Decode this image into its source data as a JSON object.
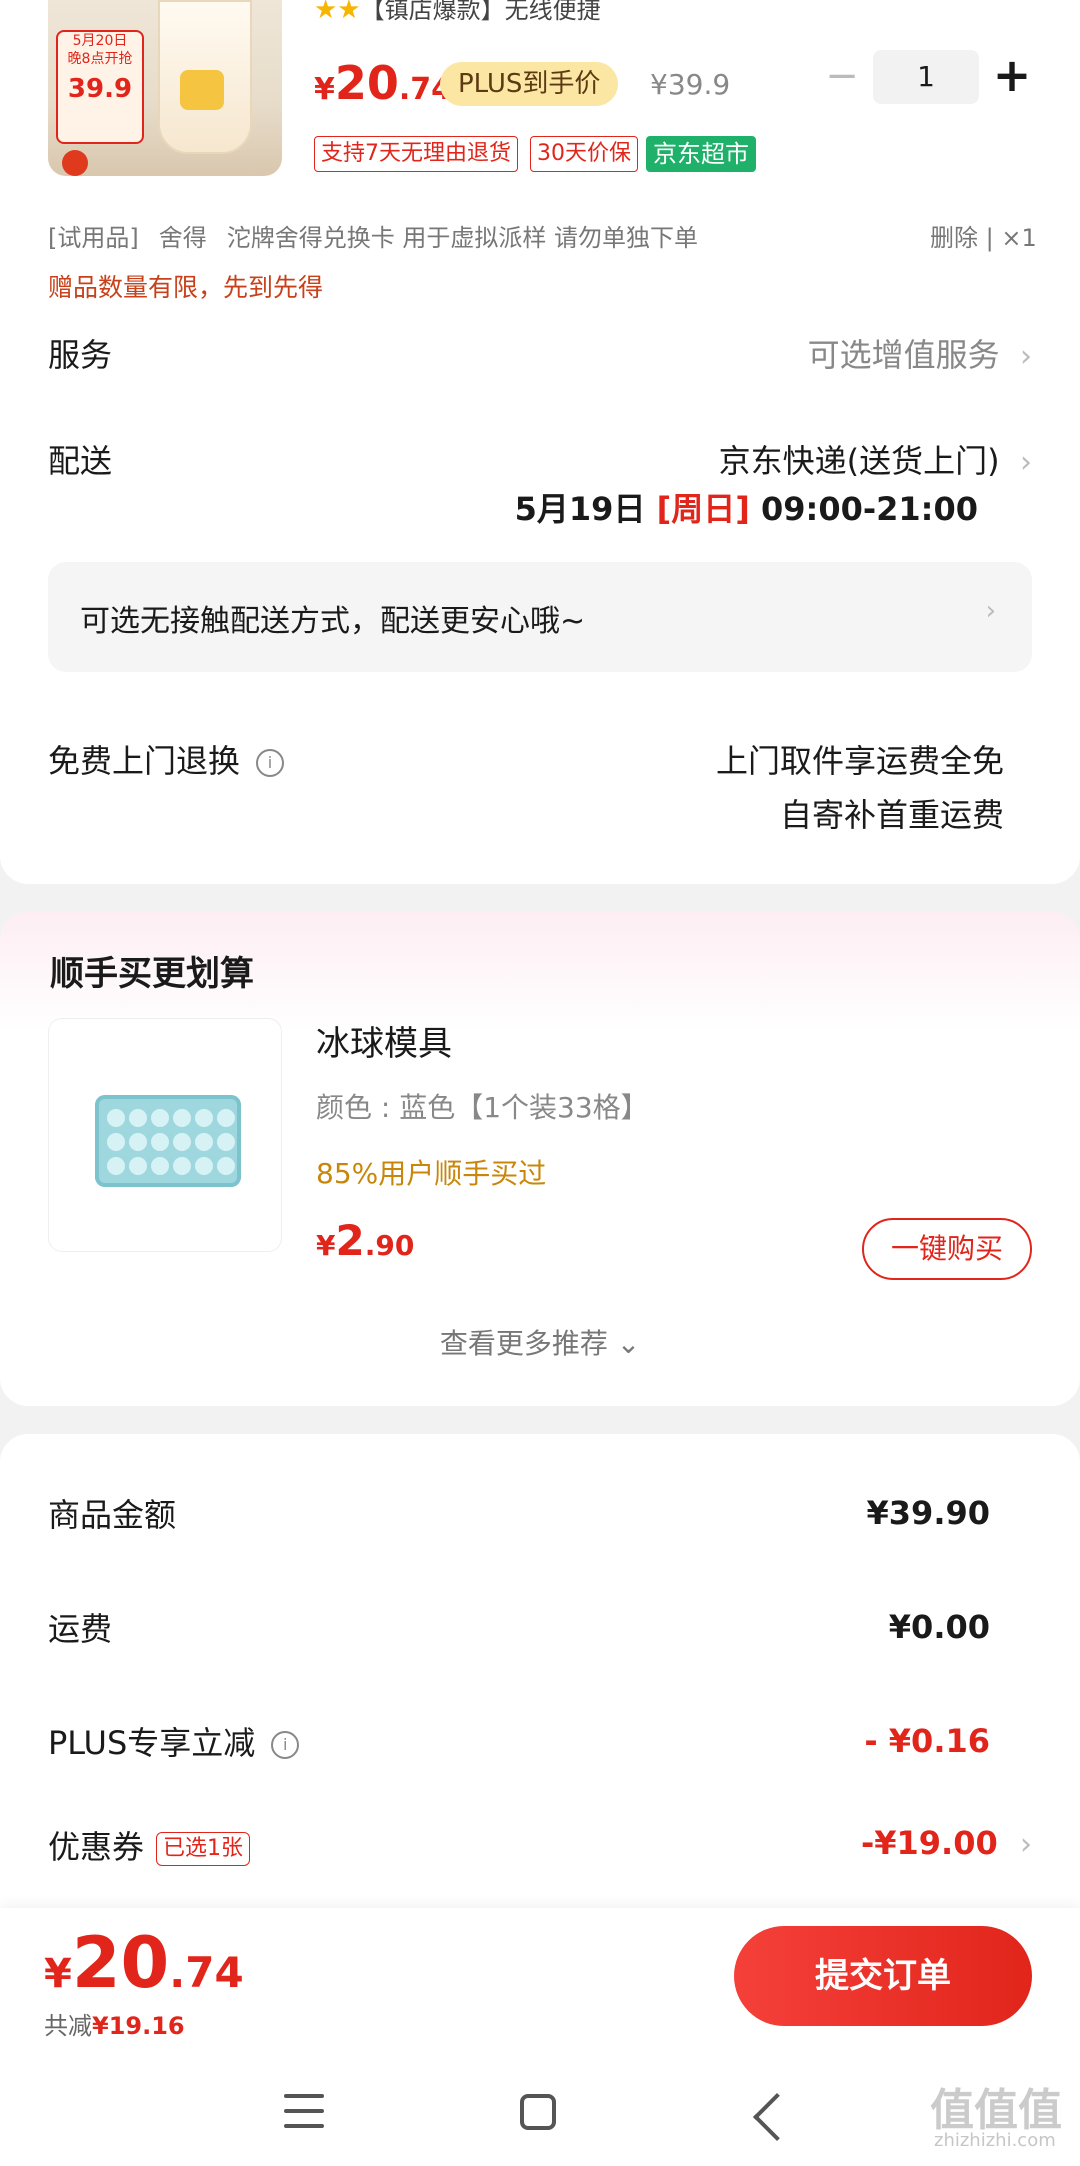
{
  "product": {
    "title": "【镇店爆款】无线便捷",
    "stars": "★★",
    "thumb_badge_line1": "5月20日",
    "thumb_badge_line2": "晚8点开抢",
    "thumb_badge_price": "39.9",
    "price_currency": "¥",
    "price_int": "20",
    "price_dec": ".74",
    "plus_tag": "PLUS到手价",
    "original_price": "¥39.9",
    "quantity": "1",
    "minus_label": "−",
    "plus_label": "+",
    "tags": [
      "支持7天无理由退货",
      "30天价保"
    ],
    "supermarket_tag": "京东超市"
  },
  "gift": {
    "prefix": "[试用品]",
    "brand": "舍得",
    "name": "沱牌舍得兑换卡 用于虚拟派样 请勿单独下单",
    "delete": "删除",
    "qty": "×1",
    "note": "赠品数量有限，先到先得"
  },
  "service": {
    "label": "服务",
    "value": "可选增值服务"
  },
  "delivery": {
    "label": "配送",
    "method": "京东快递(送货上门)",
    "date": "5月19日",
    "weekday": "[周日]",
    "time": "09:00-21:00",
    "contactless": "可选无接触配送方式，配送更安心哦~"
  },
  "returns": {
    "label": "免费上门退换",
    "line1": "上门取件享运费全免",
    "line2": "自寄补首重运费"
  },
  "recommend": {
    "title": "顺手买更划算",
    "item_name": "冰球模具",
    "item_attr": "颜色 : 蓝色【1个装33格】",
    "item_bought": "85%用户顺手买过",
    "price_currency": "¥",
    "price_int": "2",
    "price_dec": ".90",
    "buy_label": "一键购买",
    "see_more": "查看更多推荐 ⌄"
  },
  "summary": {
    "goods_label": "商品金额",
    "goods_value": "¥39.90",
    "shipping_label": "运费",
    "shipping_value": "¥0.00",
    "plus_label": "PLUS专享立减",
    "plus_value": "- ¥0.16",
    "coupon_label": "优惠券",
    "coupon_tag": "已选1张",
    "coupon_value": "-¥19.00"
  },
  "footer": {
    "total_currency": "¥",
    "total_int": "20",
    "total_dec": ".74",
    "discount_prefix": "共减",
    "discount_value": "¥19.16",
    "submit_label": "提交订单"
  },
  "watermark": {
    "text": "值值值",
    "sub": "zhizhizhi.com"
  },
  "colors": {
    "accent": "#e1251b",
    "jd_green": "#1fb16a",
    "plus_gold": "#fbe6a4"
  }
}
